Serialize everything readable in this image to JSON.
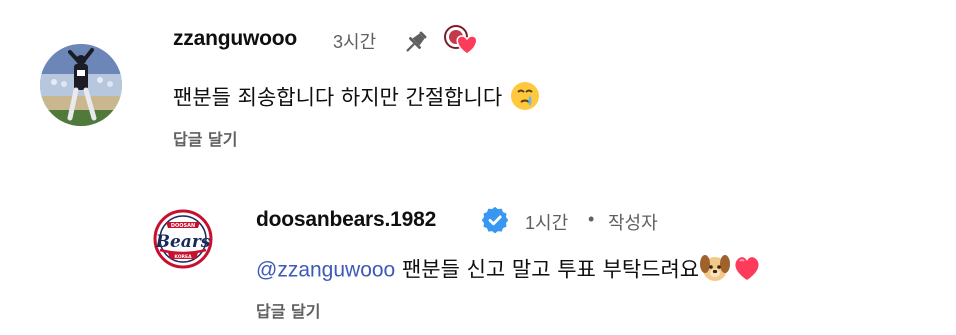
{
  "comments": [
    {
      "author": "zzanguwooo",
      "time": "3시간",
      "text": "팬분들 죄송합니다 하지만 간절합니다",
      "reply_label": "답글 달기"
    }
  ],
  "reply": {
    "author": "doosanbears.1982",
    "time": "1시간",
    "separator": "•",
    "author_badge": "작성자",
    "mention": "@zzanguwooo",
    "text": "팬분들 신고 말고 투표 부탁드려요",
    "reply_label": "답글 달기"
  },
  "logo_text": {
    "top": "DOOSAN",
    "main": "Bears",
    "bottom": "KOREA"
  },
  "colors": {
    "verified": "#3897f0",
    "mention": "#3e5ab8",
    "heart": "#ff3b5c",
    "meta": "#606060"
  },
  "icons": [
    "pin-icon",
    "creator-heart-icon",
    "crying-face-emoji",
    "verified-badge-icon",
    "dog-face-emoji",
    "heart-emoji"
  ]
}
